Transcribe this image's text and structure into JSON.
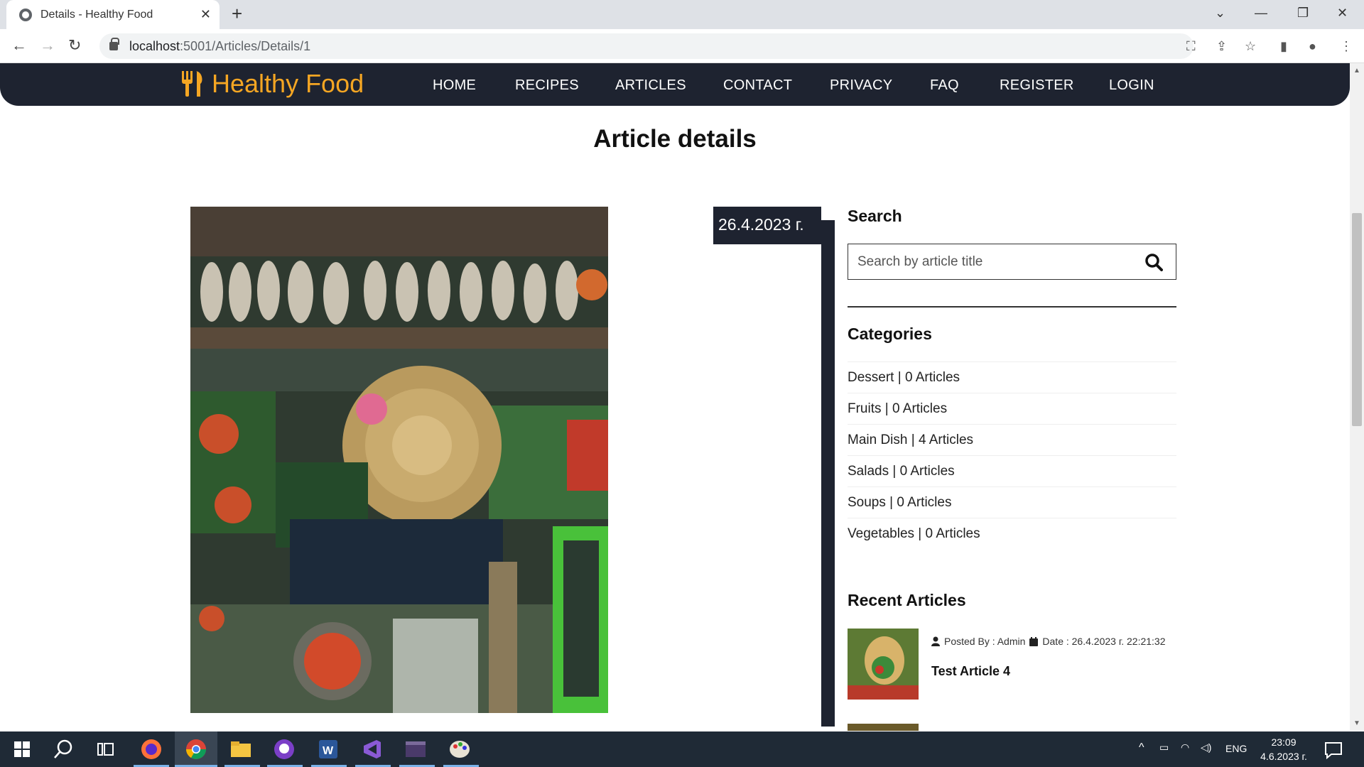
{
  "browser": {
    "tab_title": "Details - Healthy Food",
    "url_host": "localhost",
    "url_path": ":5001/Articles/Details/1"
  },
  "site": {
    "brand": "Healthy Food",
    "menu": [
      "HOME",
      "RECIPES",
      "ARTICLES",
      "CONTACT",
      "PRIVACY",
      "FAQ",
      "REGISTER",
      "LOGIN"
    ],
    "accent_color": "#f5a623",
    "nav_color": "#1e2330"
  },
  "page": {
    "title": "Article details",
    "date": "26.4.2023 г."
  },
  "sidebar": {
    "search_heading": "Search",
    "search_placeholder": "Search by article title",
    "categories_heading": "Categories",
    "categories": [
      "Dessert | 0 Articles",
      "Fruits | 0 Articles",
      "Main Dish | 4 Articles",
      "Salads | 0 Articles",
      "Soups | 0 Articles",
      "Vegetables | 0 Articles"
    ],
    "recent_heading": "Recent Articles",
    "recent": [
      {
        "posted_by": "Posted By : Admin",
        "date": "Date : 26.4.2023 г. 22:21:32",
        "title": "Test Article 4"
      }
    ]
  },
  "taskbar": {
    "lang": "ENG",
    "time": "23:09",
    "date": "4.6.2023 г."
  }
}
